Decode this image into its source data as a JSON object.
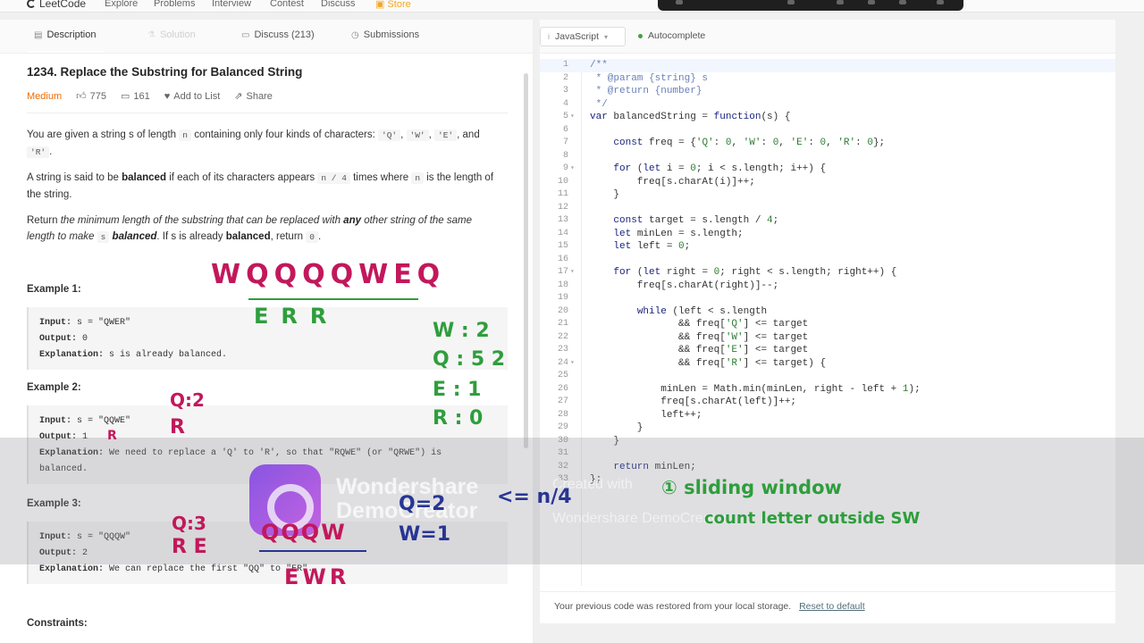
{
  "topnav": {
    "logo": "LeetCode",
    "items": [
      "Explore",
      "Problems",
      "Interview",
      "Contest",
      "Discuss"
    ],
    "store": "Store"
  },
  "tabs": {
    "description": "Description",
    "solution": "Solution",
    "discuss": "Discuss (213)",
    "submissions": "Submissions"
  },
  "problem": {
    "title": "1234. Replace the Substring for Balanced String",
    "difficulty": "Medium",
    "likes": "775",
    "dislikes": "161",
    "add_to_list": "Add to List",
    "share": "Share",
    "p1_a": "You are given a string s of length",
    "p1_n": "n",
    "p1_b": "containing only four kinds of characters:",
    "q": "'Q'",
    "w": "'W'",
    "e": "'E'",
    "and": "and",
    "r": "'R'",
    "p2_a": "A string is said to be",
    "p2_bal": "balanced",
    "p2_b": "if each of its characters appears",
    "p2_code": "n / 4",
    "p2_c": "times where",
    "p2_n": "n",
    "p2_d": "is the length of the string.",
    "p3_a": "Return",
    "p3_i1": "the minimum length of the substring that can be replaced with",
    "p3_any": "any",
    "p3_i2": "other string of the same length to make",
    "p3_s": "s",
    "p3_bal": "balanced",
    "p3_b": ". If s is already",
    "p3_bal2": "balanced",
    "p3_c": ", return",
    "p3_zero": "0",
    "constraints": "Constraints:"
  },
  "examples": [
    {
      "title": "Example 1:",
      "input_label": "Input:",
      "input": "s = \"QWER\"",
      "output_label": "Output:",
      "output": "0",
      "expl_label": "Explanation:",
      "explanation": "s is already balanced."
    },
    {
      "title": "Example 2:",
      "input_label": "Input:",
      "input": "s = \"QQWE\"",
      "output_label": "Output:",
      "output": "1",
      "expl_label": "Explanation:",
      "explanation": "We need to replace a 'Q' to 'R', so that \"RQWE\" (or \"QRWE\") is",
      "explanation2": "balanced."
    },
    {
      "title": "Example 3:",
      "input_label": "Input:",
      "input": "s = \"QQQW\"",
      "output_label": "Output:",
      "output": "2",
      "expl_label": "Explanation:",
      "explanation": "We can replace the first \"QQ\" to \"ER\"."
    }
  ],
  "editor": {
    "language": "JavaScript",
    "autocomplete": "Autocomplete",
    "status": "Your previous code was restored from your local storage.",
    "reset": "Reset to default",
    "lines": [
      "/**",
      " * @param {string} s",
      " * @return {number}",
      " */",
      "var balancedString = function(s) {",
      "",
      "    const freq = {'Q': 0, 'W': 0, 'E': 0, 'R': 0};",
      "",
      "    for (let i = 0; i < s.length; i++) {",
      "        freq[s.charAt(i)]++;",
      "    }",
      "",
      "    const target = s.length / 4;",
      "    let minLen = s.length;",
      "    let left = 0;",
      "",
      "    for (let right = 0; right < s.length; right++) {",
      "        freq[s.charAt(right)]--;",
      "",
      "        while (left < s.length",
      "               && freq['Q'] <= target",
      "               && freq['W'] <= target",
      "               && freq['E'] <= target",
      "               && freq['R'] <= target) {",
      "",
      "            minLen = Math.min(minLen, right - left + 1);",
      "            freq[s.charAt(left)]++;",
      "            left++;",
      "        }",
      "    }",
      "",
      "    return minLen;",
      "};"
    ]
  },
  "watermark": {
    "line1": "Wondershare",
    "line2": "DemoCreator",
    "created": "Created with",
    "created2": "Wondershare DemoCreator"
  },
  "annotations": {
    "top_string": "WQQQQWEQ",
    "top_sub": "ERR",
    "count_w": "W : 2",
    "count_q": "Q : 5 2",
    "count_e": "E : 1",
    "count_r": "R : 0",
    "ex2_q": "Q:2",
    "ex2_r": "R",
    "ex2_r2": "R",
    "ex3_q": "Q:3",
    "ex3_re": "R E",
    "ex3_str": "QQQW",
    "ex3_sub": "EWR",
    "blue_q": "Q=2",
    "blue_w": "W=1",
    "blue_le": "<= n/4",
    "note1": "① sliding window",
    "note2": "count letter outside SW"
  }
}
